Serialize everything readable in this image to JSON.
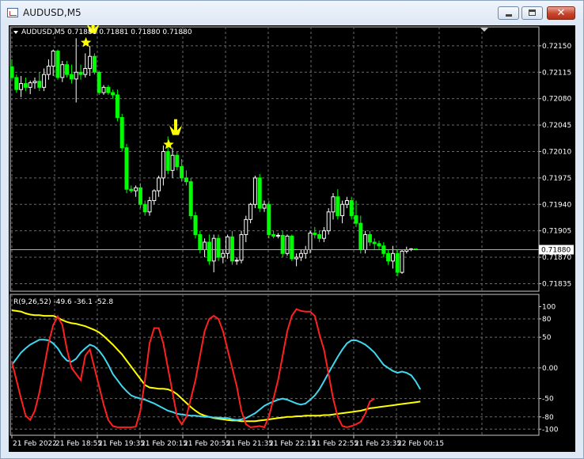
{
  "window": {
    "title": "AUDUSD,M5",
    "minimize_glyph": "",
    "maximize_glyph": "",
    "close_glyph": "✕"
  },
  "main_panel": {
    "header": "AUDUSD,M5  0.71881 0.71881 0.71880 0.71880",
    "header_marker": "▼",
    "current_price_label": "0.71880",
    "price_axis_labels": [
      "0.72150",
      "0.72115",
      "0.72080",
      "0.72045",
      "0.72010",
      "0.71975",
      "0.71940",
      "0.71905",
      "0.71870",
      "0.71835"
    ]
  },
  "sub_panel": {
    "header": "R(9,26,52) -49.6 -36.1 -52.8",
    "axis_labels": [
      "100",
      "80",
      "50",
      "0.00",
      "-50",
      "-80",
      "-100"
    ],
    "colors": {
      "slow": "#ffff00",
      "medium": "#40d8f0",
      "fast": "#ff2020"
    }
  },
  "time_axis_labels": [
    "21 Feb 2022",
    "21 Feb 18:55",
    "21 Feb 19:35",
    "21 Feb 20:15",
    "21 Feb 20:55",
    "21 Feb 21:35",
    "21 Feb 22:15",
    "21 Feb 22:55",
    "21 Feb 23:35",
    "22 Feb 00:15"
  ],
  "signals": [
    {
      "icon": "down-arrow-icon",
      "marker": "star-icon",
      "color": "#ffff00"
    },
    {
      "icon": "down-arrow-icon",
      "marker": "star-icon",
      "color": "#ffff00"
    }
  ],
  "chart_data": {
    "type": "candlestick",
    "symbol": "AUDUSD",
    "timeframe": "M5",
    "bull_color": "#ffffff",
    "bear_color": "#00ff00",
    "grid": true,
    "price_ylim": [
      0.71825,
      0.72175
    ],
    "last_price": 0.7188,
    "candles": [
      {
        "o": 0.72122,
        "h": 0.72132,
        "l": 0.72105,
        "c": 0.72108
      },
      {
        "o": 0.72108,
        "h": 0.72112,
        "l": 0.72088,
        "c": 0.72092
      },
      {
        "o": 0.72092,
        "h": 0.7211,
        "l": 0.72082,
        "c": 0.721
      },
      {
        "o": 0.721,
        "h": 0.72108,
        "l": 0.7209,
        "c": 0.72095
      },
      {
        "o": 0.72095,
        "h": 0.72104,
        "l": 0.72086,
        "c": 0.72101
      },
      {
        "o": 0.72101,
        "h": 0.72108,
        "l": 0.72093,
        "c": 0.72103
      },
      {
        "o": 0.72103,
        "h": 0.72115,
        "l": 0.7209,
        "c": 0.72095
      },
      {
        "o": 0.72095,
        "h": 0.7212,
        "l": 0.7209,
        "c": 0.72112
      },
      {
        "o": 0.72112,
        "h": 0.72132,
        "l": 0.72105,
        "c": 0.72123
      },
      {
        "o": 0.72123,
        "h": 0.72145,
        "l": 0.7211,
        "c": 0.72143
      },
      {
        "o": 0.72143,
        "h": 0.72145,
        "l": 0.72105,
        "c": 0.72108
      },
      {
        "o": 0.72108,
        "h": 0.7213,
        "l": 0.72102,
        "c": 0.72125
      },
      {
        "o": 0.72125,
        "h": 0.7213,
        "l": 0.72108,
        "c": 0.72112
      },
      {
        "o": 0.72112,
        "h": 0.72125,
        "l": 0.721,
        "c": 0.72106
      },
      {
        "o": 0.72106,
        "h": 0.7216,
        "l": 0.72075,
        "c": 0.72115
      },
      {
        "o": 0.72115,
        "h": 0.72125,
        "l": 0.72105,
        "c": 0.72112
      },
      {
        "o": 0.72112,
        "h": 0.7214,
        "l": 0.72108,
        "c": 0.7212
      },
      {
        "o": 0.7212,
        "h": 0.7215,
        "l": 0.7211,
        "c": 0.72136
      },
      {
        "o": 0.72136,
        "h": 0.7214,
        "l": 0.72112,
        "c": 0.72115
      },
      {
        "o": 0.72115,
        "h": 0.72117,
        "l": 0.72085,
        "c": 0.72088
      },
      {
        "o": 0.72088,
        "h": 0.72098,
        "l": 0.72085,
        "c": 0.72095
      },
      {
        "o": 0.72095,
        "h": 0.72098,
        "l": 0.72085,
        "c": 0.72088
      },
      {
        "o": 0.72088,
        "h": 0.72092,
        "l": 0.7208,
        "c": 0.72085
      },
      {
        "o": 0.72085,
        "h": 0.72092,
        "l": 0.7205,
        "c": 0.72055
      },
      {
        "o": 0.72055,
        "h": 0.7206,
        "l": 0.7201,
        "c": 0.72015
      },
      {
        "o": 0.72015,
        "h": 0.7202,
        "l": 0.71955,
        "c": 0.7196
      },
      {
        "o": 0.7196,
        "h": 0.71965,
        "l": 0.71955,
        "c": 0.71958
      },
      {
        "o": 0.71958,
        "h": 0.71965,
        "l": 0.7195,
        "c": 0.71962
      },
      {
        "o": 0.71962,
        "h": 0.71968,
        "l": 0.71935,
        "c": 0.7194
      },
      {
        "o": 0.7194,
        "h": 0.71945,
        "l": 0.71925,
        "c": 0.7193
      },
      {
        "o": 0.7193,
        "h": 0.7195,
        "l": 0.71925,
        "c": 0.71945
      },
      {
        "o": 0.71945,
        "h": 0.7196,
        "l": 0.7194,
        "c": 0.71958
      },
      {
        "o": 0.71958,
        "h": 0.71978,
        "l": 0.7195,
        "c": 0.71975
      },
      {
        "o": 0.71975,
        "h": 0.72018,
        "l": 0.71965,
        "c": 0.7201
      },
      {
        "o": 0.7201,
        "h": 0.7203,
        "l": 0.7198,
        "c": 0.71985
      },
      {
        "o": 0.71985,
        "h": 0.72015,
        "l": 0.71975,
        "c": 0.72005
      },
      {
        "o": 0.72005,
        "h": 0.7201,
        "l": 0.71985,
        "c": 0.7199
      },
      {
        "o": 0.7199,
        "h": 0.72,
        "l": 0.7197,
        "c": 0.71975
      },
      {
        "o": 0.71975,
        "h": 0.71985,
        "l": 0.71965,
        "c": 0.7197
      },
      {
        "o": 0.7197,
        "h": 0.71975,
        "l": 0.7192,
        "c": 0.71925
      },
      {
        "o": 0.71925,
        "h": 0.7193,
        "l": 0.71895,
        "c": 0.719
      },
      {
        "o": 0.719,
        "h": 0.71905,
        "l": 0.71875,
        "c": 0.7188
      },
      {
        "o": 0.7188,
        "h": 0.71895,
        "l": 0.7187,
        "c": 0.7189
      },
      {
        "o": 0.7189,
        "h": 0.719,
        "l": 0.7186,
        "c": 0.71865
      },
      {
        "o": 0.71865,
        "h": 0.719,
        "l": 0.7185,
        "c": 0.71895
      },
      {
        "o": 0.71895,
        "h": 0.719,
        "l": 0.71865,
        "c": 0.7187
      },
      {
        "o": 0.7187,
        "h": 0.7188,
        "l": 0.71862,
        "c": 0.71875
      },
      {
        "o": 0.71875,
        "h": 0.719,
        "l": 0.71868,
        "c": 0.71897
      },
      {
        "o": 0.71897,
        "h": 0.71905,
        "l": 0.7186,
        "c": 0.71865
      },
      {
        "o": 0.71865,
        "h": 0.7187,
        "l": 0.7186,
        "c": 0.71866
      },
      {
        "o": 0.71866,
        "h": 0.71905,
        "l": 0.71862,
        "c": 0.719
      },
      {
        "o": 0.719,
        "h": 0.71925,
        "l": 0.7189,
        "c": 0.7192
      },
      {
        "o": 0.7192,
        "h": 0.71942,
        "l": 0.71915,
        "c": 0.7194
      },
      {
        "o": 0.7194,
        "h": 0.71978,
        "l": 0.71935,
        "c": 0.71975
      },
      {
        "o": 0.71975,
        "h": 0.7198,
        "l": 0.7193,
        "c": 0.71935
      },
      {
        "o": 0.71935,
        "h": 0.71945,
        "l": 0.7193,
        "c": 0.7194
      },
      {
        "o": 0.7194,
        "h": 0.71945,
        "l": 0.71895,
        "c": 0.719
      },
      {
        "o": 0.719,
        "h": 0.71905,
        "l": 0.71895,
        "c": 0.71898
      },
      {
        "o": 0.71898,
        "h": 0.71902,
        "l": 0.71895,
        "c": 0.71899
      },
      {
        "o": 0.71899,
        "h": 0.71905,
        "l": 0.7187,
        "c": 0.71875
      },
      {
        "o": 0.71875,
        "h": 0.719,
        "l": 0.71872,
        "c": 0.71898
      },
      {
        "o": 0.71898,
        "h": 0.719,
        "l": 0.71865,
        "c": 0.71868
      },
      {
        "o": 0.71868,
        "h": 0.71875,
        "l": 0.71858,
        "c": 0.7187
      },
      {
        "o": 0.7187,
        "h": 0.7188,
        "l": 0.71865,
        "c": 0.71875
      },
      {
        "o": 0.71875,
        "h": 0.71885,
        "l": 0.71868,
        "c": 0.7188
      },
      {
        "o": 0.7188,
        "h": 0.71905,
        "l": 0.71875,
        "c": 0.71902
      },
      {
        "o": 0.71902,
        "h": 0.7191,
        "l": 0.71895,
        "c": 0.719
      },
      {
        "o": 0.719,
        "h": 0.71905,
        "l": 0.7189,
        "c": 0.71895
      },
      {
        "o": 0.71895,
        "h": 0.7191,
        "l": 0.7189,
        "c": 0.71905
      },
      {
        "o": 0.71905,
        "h": 0.71935,
        "l": 0.719,
        "c": 0.7193
      },
      {
        "o": 0.7193,
        "h": 0.71955,
        "l": 0.7192,
        "c": 0.7195
      },
      {
        "o": 0.7195,
        "h": 0.7196,
        "l": 0.7192,
        "c": 0.71925
      },
      {
        "o": 0.71925,
        "h": 0.71945,
        "l": 0.71915,
        "c": 0.7194
      },
      {
        "o": 0.7194,
        "h": 0.7195,
        "l": 0.71935,
        "c": 0.71945
      },
      {
        "o": 0.71945,
        "h": 0.7195,
        "l": 0.7192,
        "c": 0.71925
      },
      {
        "o": 0.71925,
        "h": 0.71945,
        "l": 0.7191,
        "c": 0.71915
      },
      {
        "o": 0.71915,
        "h": 0.71925,
        "l": 0.71875,
        "c": 0.7188
      },
      {
        "o": 0.7188,
        "h": 0.71905,
        "l": 0.71875,
        "c": 0.719
      },
      {
        "o": 0.719,
        "h": 0.71905,
        "l": 0.71885,
        "c": 0.7189
      },
      {
        "o": 0.7189,
        "h": 0.71895,
        "l": 0.7188,
        "c": 0.71888
      },
      {
        "o": 0.71888,
        "h": 0.71892,
        "l": 0.7188,
        "c": 0.71885
      },
      {
        "o": 0.71885,
        "h": 0.7189,
        "l": 0.7187,
        "c": 0.71875
      },
      {
        "o": 0.71875,
        "h": 0.7188,
        "l": 0.7186,
        "c": 0.71865
      },
      {
        "o": 0.71865,
        "h": 0.71885,
        "l": 0.71855,
        "c": 0.71875
      },
      {
        "o": 0.71875,
        "h": 0.7188,
        "l": 0.71845,
        "c": 0.7185
      },
      {
        "o": 0.7185,
        "h": 0.7188,
        "l": 0.71848,
        "c": 0.71878
      },
      {
        "o": 0.71878,
        "h": 0.71884,
        "l": 0.71875,
        "c": 0.7188
      },
      {
        "o": 0.7188,
        "h": 0.71882,
        "l": 0.71878,
        "c": 0.71881
      },
      {
        "o": 0.71881,
        "h": 0.71881,
        "l": 0.7188,
        "c": 0.7188
      }
    ],
    "signal_candles": [
      17,
      35
    ],
    "indicator": {
      "name": "R(9,26,52)",
      "ylim": [
        -110,
        120
      ],
      "series": [
        {
          "name": "slow",
          "values": [
            94,
            93,
            92,
            89,
            87,
            86,
            86,
            85,
            85,
            85,
            82,
            78,
            75,
            73,
            72,
            70,
            68,
            65,
            62,
            58,
            52,
            45,
            38,
            30,
            22,
            12,
            2,
            -8,
            -18,
            -28,
            -32,
            -33,
            -34,
            -34,
            -35,
            -38,
            -43,
            -50,
            -57,
            -64,
            -70,
            -75,
            -78,
            -80,
            -82,
            -83,
            -84,
            -85,
            -86,
            -86,
            -87,
            -87,
            -87,
            -87,
            -86,
            -85,
            -84,
            -83,
            -82,
            -81,
            -80,
            -80,
            -79,
            -79,
            -78,
            -78,
            -78,
            -78,
            -77,
            -77,
            -76,
            -75,
            -74,
            -73,
            -72,
            -71,
            -70,
            -68,
            -66,
            -65,
            -64,
            -63,
            -62,
            -61,
            -60,
            -59,
            -58,
            -57,
            -56,
            -55
          ]
        },
        {
          "name": "medium",
          "values": [
            5,
            15,
            25,
            32,
            38,
            42,
            46,
            46,
            45,
            40,
            32,
            20,
            12,
            10,
            15,
            25,
            32,
            38,
            35,
            28,
            18,
            5,
            -10,
            -20,
            -30,
            -38,
            -45,
            -48,
            -50,
            -52,
            -55,
            -58,
            -62,
            -66,
            -70,
            -72,
            -75,
            -76,
            -77,
            -78,
            -78,
            -79,
            -80,
            -80,
            -81,
            -81,
            -82,
            -82,
            -84,
            -85,
            -84,
            -82,
            -78,
            -74,
            -68,
            -62,
            -58,
            -55,
            -52,
            -50,
            -52,
            -55,
            -58,
            -60,
            -58,
            -52,
            -45,
            -35,
            -22,
            -8,
            5,
            18,
            30,
            40,
            45,
            45,
            42,
            38,
            32,
            25,
            15,
            5,
            0,
            -5,
            -8,
            -6,
            -8,
            -12,
            -22,
            -35
          ]
        },
        {
          "name": "fast",
          "values": [
            10,
            -20,
            -50,
            -78,
            -85,
            -70,
            -40,
            0,
            40,
            70,
            84,
            70,
            30,
            0,
            -10,
            -20,
            20,
            30,
            0,
            -30,
            -60,
            -85,
            -95,
            -97,
            -97,
            -97,
            -97,
            -96,
            -70,
            -20,
            40,
            65,
            65,
            40,
            0,
            -40,
            -80,
            -92,
            -80,
            -50,
            -20,
            20,
            60,
            80,
            85,
            80,
            60,
            30,
            0,
            -30,
            -70,
            -92,
            -97,
            -96,
            -95,
            -97,
            -80,
            -50,
            -20,
            20,
            60,
            85,
            96,
            93,
            92,
            92,
            85,
            55,
            30,
            -10,
            -50,
            -80,
            -95,
            -97,
            -95,
            -92,
            -88,
            -75,
            -55,
            -50
          ]
        }
      ]
    }
  }
}
